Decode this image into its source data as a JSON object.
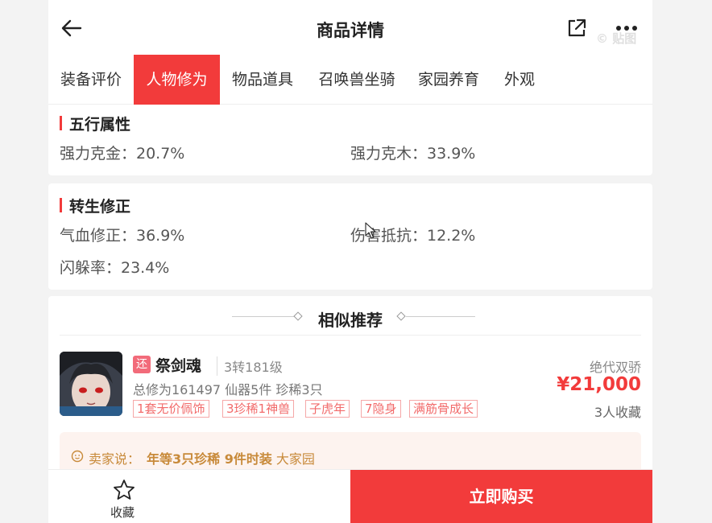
{
  "header": {
    "title": "商品详情",
    "watermark": "© 贴图"
  },
  "tabs": [
    "装备评价",
    "人物修为",
    "物品道具",
    "召唤兽坐骑",
    "家园养育",
    "外观"
  ],
  "active_tab": 1,
  "wuxing": {
    "title": "五行属性",
    "attrs": [
      "强力克金：20.7%",
      "强力克木：33.9%"
    ]
  },
  "zhuansheng": {
    "title": "转生修正",
    "attrs": [
      "气血修正：36.9%",
      "伤害抵抗：12.2%",
      "闪躲率：23.4%"
    ]
  },
  "recommend": {
    "title": "相似推荐",
    "item": {
      "badge": "还",
      "name": "祭剑魂",
      "level": "3转181级",
      "desc": "总修为161497  仙器5件  珍稀3只",
      "tags": [
        "1套无价佩饰",
        "3珍稀1神兽",
        "子虎年",
        "7隐身",
        "满筋骨成长"
      ],
      "server": "绝代双骄",
      "price": "¥21,000",
      "favorites": "3人收藏"
    },
    "seller": {
      "label": "卖家说：",
      "highlight": "年等3只珍稀 9件时装",
      "rest": " 大家园"
    }
  },
  "bottom": {
    "favorite_label": "收藏",
    "buy_label": "立即购买"
  },
  "colors": {
    "accent": "#f23b3b",
    "seller_text": "#c88a3a"
  }
}
